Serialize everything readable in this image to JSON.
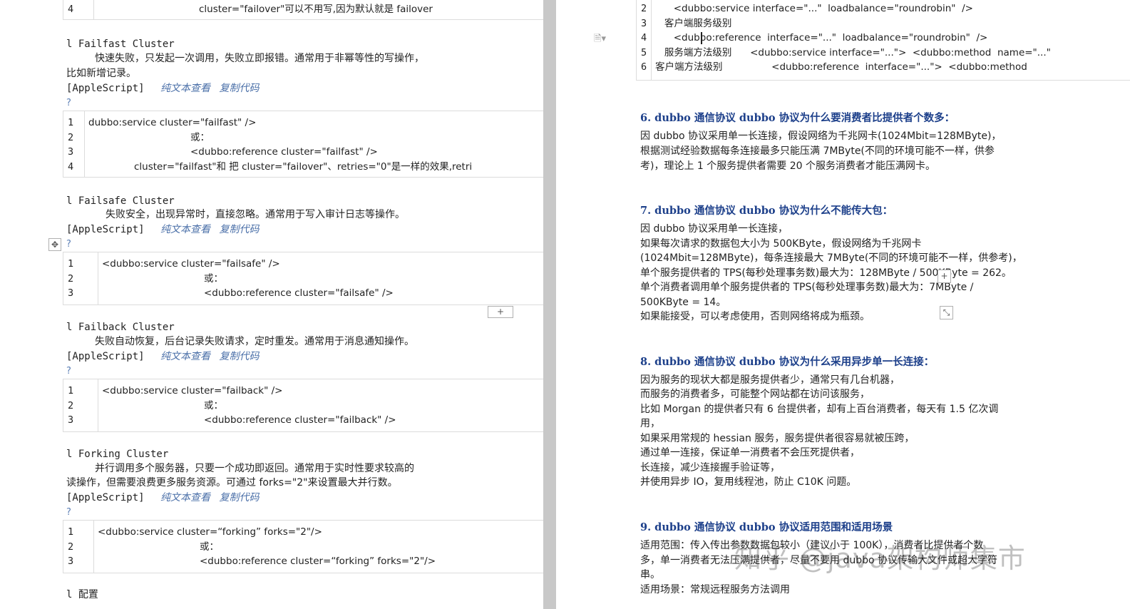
{
  "left": {
    "top_row": {
      "num": "4",
      "text": "cluster=\"failover\"可以不用写,因为默认就是 failover"
    },
    "failfast": {
      "title": "l Failfast Cluster",
      "desc1": "快速失败，只发起一次调用，失败立即报错。通常用于非幂等性的写操作，",
      "desc2": "比如新增记录。",
      "lang": "[AppleScript]",
      "view_plain": "纯文本查看",
      "copy": "复制代码",
      "q": "?",
      "lines": [
        {
          "n": "1",
          "t": "dubbo:service cluster=\"failfast\"  />"
        },
        {
          "n": "2",
          "t": "或："
        },
        {
          "n": "3",
          "t": "<dubbo:reference  cluster=\"failfast\"  />"
        },
        {
          "n": "4",
          "t": "cluster=\"failfast\"和 把 cluster=\"failover\"、retries=\"0\"是一样的效果,retri"
        }
      ]
    },
    "failsafe": {
      "title": "l Failsafe Cluster",
      "desc1": "失败安全，出现异常时，直接忽略。通常用于写入审计日志等操作。",
      "lang": "[AppleScript]",
      "view_plain": "纯文本查看",
      "copy": "复制代码",
      "q": "?",
      "lines": [
        {
          "n": "1",
          "t": "<dubbo:service cluster=\"failsafe\"  />"
        },
        {
          "n": "2",
          "t": "或："
        },
        {
          "n": "3",
          "t": "<dubbo:reference  cluster=\"failsafe\"  />"
        }
      ]
    },
    "failback": {
      "title": "l Failback Cluster",
      "desc1": "失败自动恢复，后台记录失败请求，定时重发。通常用于消息通知操作。",
      "lang": "[AppleScript]",
      "view_plain": "纯文本查看",
      "copy": "复制代码",
      "q": "?",
      "lines": [
        {
          "n": "1",
          "t": "<dubbo:service cluster=\"failback\"  />"
        },
        {
          "n": "2",
          "t": "或："
        },
        {
          "n": "3",
          "t": "<dubbo:reference  cluster=\"failback\"  />"
        }
      ]
    },
    "forking": {
      "title": "l Forking Cluster",
      "desc1": "并行调用多个服务器，只要一个成功即返回。通常用于实时性要求较高的",
      "desc2": "读操作，但需要浪费更多服务资源。可通过 forks=\"2\"来设置最大并行数。",
      "lang": "[AppleScript]",
      "view_plain": "纯文本查看",
      "copy": "复制代码",
      "q": "?",
      "lines": [
        {
          "n": "1",
          "t": "<dubbo:service cluster=“forking” forks=\"2\"/>"
        },
        {
          "n": "2",
          "t": "或："
        },
        {
          "n": "3",
          "t": "<dubbo:reference cluster=“forking”  forks=\"2\"/>"
        }
      ]
    },
    "config_title": "l 配置",
    "plus": "+"
  },
  "right": {
    "top_lines": [
      {
        "n": "2",
        "t": "      <dubbo:service interface=\"...\"  loadbalance=\"roundrobin\"  />"
      },
      {
        "n": "3",
        "t": "   客户端服务级别"
      },
      {
        "n": "4",
        "t": "      <dubbo:reference  interface=\"...\"  loadbalance=\"roundrobin\"  />"
      },
      {
        "n": "5",
        "t": "   服务端方法级别      <dubbo:service interface=\"...\">  <dubbo:method  name=\"...\""
      },
      {
        "n": "6",
        "t": "客户端方法级别                <dubbo:reference  interface=\"...\">  <dubbo:method"
      }
    ],
    "s6": {
      "h": "6. dubbo 通信协议 dubbo 协议为什么要消费者比提供者个数多：",
      "p": [
        "因 dubbo 协议采用单一长连接，假设网络为千兆网卡(1024Mbit=128MByte)，",
        "根据测试经验数据每条连接最多只能压满 7MByte(不同的环境可能不一样，供参",
        "考)，理论上 1 个服务提供者需要 20 个服务消费者才能压满网卡。"
      ]
    },
    "s7": {
      "h": "7. dubbo 通信协议 dubbo 协议为什么不能传大包：",
      "p": [
        "因 dubbo 协议采用单一长连接，",
        "如果每次请求的数据包大小为 500KByte，假设网络为千兆网卡",
        "(1024Mbit=128MByte)，每条连接最大 7MByte(不同的环境可能不一样，供参考)，",
        "单个服务提供者的 TPS(每秒处理事务数)最大为：128MByte / 500KByte = 262。",
        "单个消费者调用单个服务提供者的 TPS(每秒处理事务数)最大为：7MByte /",
        "500KByte = 14。",
        "如果能接受，可以考虑使用，否则网络将成为瓶颈。"
      ]
    },
    "s8": {
      "h": "8. dubbo 通信协议 dubbo 协议为什么采用异步单一长连接：",
      "p": [
        "因为服务的现状大都是服务提供者少，通常只有几台机器，",
        "而服务的消费者多，可能整个网站都在访问该服务，",
        "比如 Morgan 的提供者只有 6 台提供者，却有上百台消费者，每天有 1.5 亿次调",
        "用，",
        "如果采用常规的 hessian 服务，服务提供者很容易就被压跨，",
        "通过单一连接，保证单一消费者不会压死提供者，",
        "长连接，减少连接握手验证等，",
        "并使用异步 IO，复用线程池，防止 C10K 问题。"
      ]
    },
    "s9": {
      "h": "9. dubbo 通信协议 dubbo 协议适用范围和适用场景",
      "p": [
        "适用范围：传入传出参数数据包较小（建议小于 100K），消费者比提供者个数",
        "多，单一消费者无法压满提供者，尽量不要用 dubbo 协议传输大文件或超大字符",
        "串。",
        "适用场景：常规远程服务方法调用"
      ]
    },
    "watermark": "知乎 @java架构师集市",
    "plus": "+",
    "resize": "⤡"
  }
}
